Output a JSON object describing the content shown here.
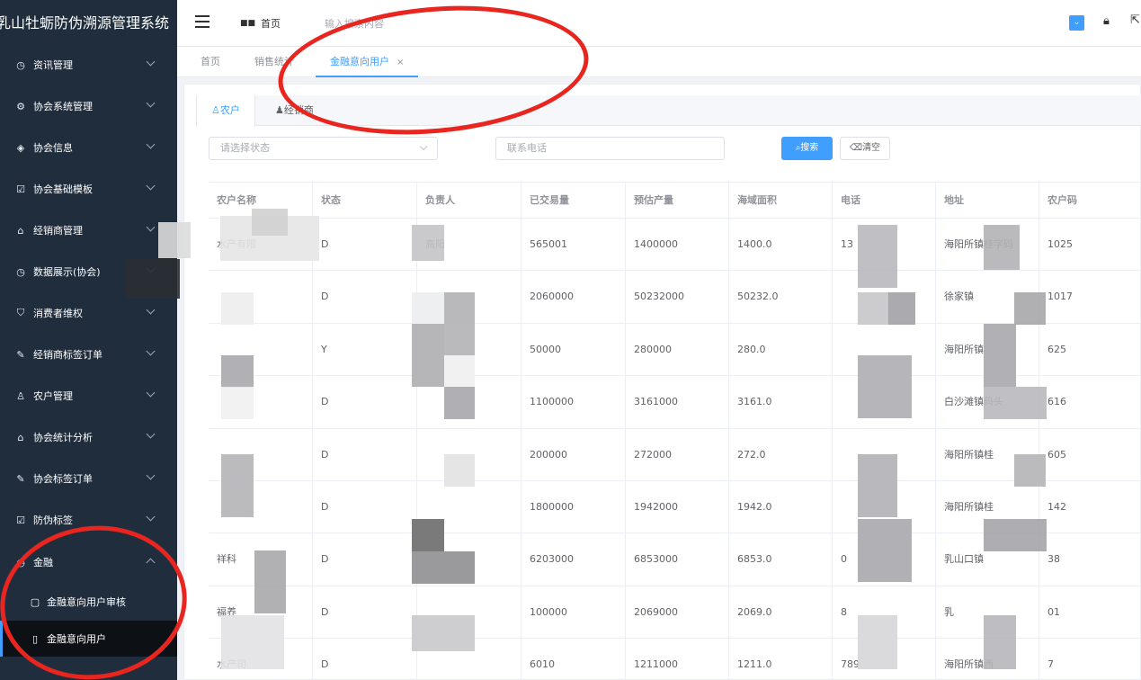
{
  "sidebar": {
    "brand": "乳山牡蛎防伪溯源管理系统",
    "items": [
      {
        "label": "资讯管理",
        "icon": "dashboard-icon",
        "glyph": "◷"
      },
      {
        "label": "协会系统管理",
        "icon": "gear-icon",
        "glyph": "⚙"
      },
      {
        "label": "协会信息",
        "icon": "tag-icon",
        "glyph": "◈"
      },
      {
        "label": "协会基础模板",
        "icon": "checkbox-icon",
        "glyph": "☑"
      },
      {
        "label": "经销商管理",
        "icon": "tree-icon",
        "glyph": "⌂"
      },
      {
        "label": "数据展示(协会)",
        "icon": "dashboard-icon",
        "glyph": "◷"
      },
      {
        "label": "消费者维权",
        "icon": "shield-icon",
        "glyph": "⛉"
      },
      {
        "label": "经销商标签订单",
        "icon": "edit-icon",
        "glyph": "✎"
      },
      {
        "label": "农户管理",
        "icon": "user-icon",
        "glyph": "♙"
      },
      {
        "label": "协会统计分析",
        "icon": "tree-icon",
        "glyph": "⌂"
      },
      {
        "label": "协会标签订单",
        "icon": "edit-icon",
        "glyph": "✎"
      },
      {
        "label": "防伪标签",
        "icon": "checkbox-icon",
        "glyph": "☑"
      },
      {
        "label": "金融",
        "icon": "dashboard-icon",
        "glyph": "◷"
      }
    ],
    "sub_items": [
      {
        "label": "金融意向用户审核",
        "icon": "wallet-icon",
        "glyph": "▢"
      },
      {
        "label": "金融意向用户",
        "icon": "document-icon",
        "glyph": "▯"
      }
    ]
  },
  "navbar": {
    "home": "首页",
    "search_placeholder": "输入搜索内容"
  },
  "tags": {
    "items": [
      "首页",
      "销售统计",
      "金融意向用户"
    ],
    "close": "×"
  },
  "subtabs": [
    "农户",
    "经销商"
  ],
  "filters": {
    "status_placeholder": "请选择状态",
    "phone_placeholder": "联系电话",
    "search_button": "搜索",
    "clear_button": "清空"
  },
  "table": {
    "columns": [
      "农户名称",
      "状态",
      "负责人",
      "已交易量",
      "预估产量",
      "海域面积",
      "电话",
      "地址",
      "农户码"
    ],
    "rows": [
      [
        "水产有限",
        "D",
        "高阳",
        "565001",
        "1400000",
        "1400.0",
        "13",
        "海阳所镇桂字码",
        "1025"
      ],
      [
        "",
        "D",
        "",
        "2060000",
        "50232000",
        "50232.0",
        "",
        "徐家镇",
        "1017"
      ],
      [
        "",
        "Y",
        "",
        "50000",
        "280000",
        "280.0",
        "",
        "海阳所镇",
        "625"
      ],
      [
        "",
        "D",
        "",
        "1100000",
        "3161000",
        "3161.0",
        "",
        "白沙滩镇码头",
        "616"
      ],
      [
        "",
        "D",
        "",
        "200000",
        "272000",
        "272.0",
        "",
        "海阳所镇桂",
        "605"
      ],
      [
        "",
        "D",
        "",
        "1800000",
        "1942000",
        "1942.0",
        "",
        "海阳所镇桂",
        "142"
      ],
      [
        "祥科",
        "D",
        "",
        "6203000",
        "6853000",
        "6853.0",
        "0",
        "乳山口镇",
        "38"
      ],
      [
        "福养",
        "D",
        "",
        "100000",
        "2069000",
        "2069.0",
        "8",
        "乳",
        "01"
      ],
      [
        "水产司",
        "D",
        "",
        "6010",
        "1211000",
        "1211.0",
        "789",
        "海阳所镇西",
        "7"
      ]
    ]
  }
}
